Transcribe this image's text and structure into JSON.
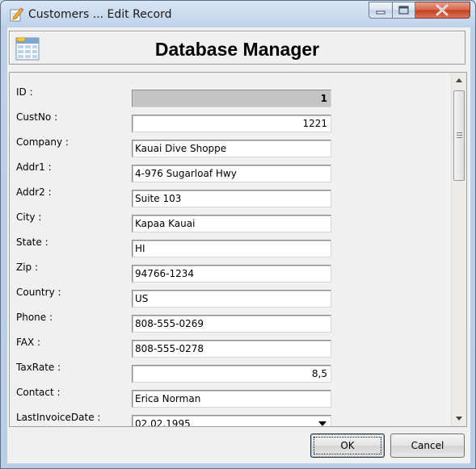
{
  "window": {
    "title": "Customers ... Edit Record"
  },
  "header": {
    "title": "Database Manager"
  },
  "fields": [
    {
      "label": "ID :",
      "value": "1"
    },
    {
      "label": "CustNo :",
      "value": "1221"
    },
    {
      "label": "Company :",
      "value": "Kauai Dive Shoppe"
    },
    {
      "label": "Addr1 :",
      "value": "4-976 Sugarloaf Hwy"
    },
    {
      "label": "Addr2 :",
      "value": "Suite 103"
    },
    {
      "label": "City :",
      "value": "Kapaa Kauai"
    },
    {
      "label": "State :",
      "value": "HI"
    },
    {
      "label": "Zip :",
      "value": "94766-1234"
    },
    {
      "label": "Country :",
      "value": "US"
    },
    {
      "label": "Phone :",
      "value": "808-555-0269"
    },
    {
      "label": "FAX :",
      "value": "808-555-0278"
    },
    {
      "label": "TaxRate :",
      "value": "8,5"
    },
    {
      "label": "Contact :",
      "value": "Erica Norman"
    },
    {
      "label": "LastInvoiceDate :",
      "value": "02.02.1995"
    }
  ],
  "buttons": {
    "ok": "OK",
    "cancel": "Cancel"
  },
  "icons": {
    "title": "edit-pencil-icon",
    "header": "database-table-icon"
  }
}
